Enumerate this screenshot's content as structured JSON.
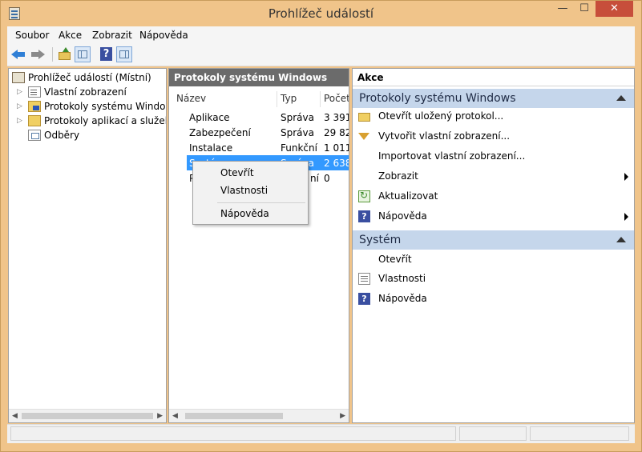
{
  "window": {
    "title": "Prohlížeč událostí",
    "close_glyph": "✕",
    "min_glyph": "—",
    "max_glyph": "☐"
  },
  "menubar": {
    "items": [
      "Soubor",
      "Akce",
      "Zobrazit",
      "Nápověda"
    ]
  },
  "tree": {
    "root": "Prohlížeč událostí (Místní)",
    "items": [
      {
        "label": "Vlastní zobrazení",
        "icon": "custom-view-icon"
      },
      {
        "label": "Protokoly systému Windows",
        "icon": "windows-logs-folder-icon"
      },
      {
        "label": "Protokoly aplikací a služeb",
        "icon": "folder-icon"
      },
      {
        "label": "Odběry",
        "icon": "subscriptions-icon"
      }
    ]
  },
  "center": {
    "header": "Protokoly systému Windows",
    "columns": [
      "Název",
      "Typ",
      "Počet"
    ],
    "rows": [
      [
        "Aplikace",
        "Správa",
        "3 391"
      ],
      [
        "Zabezpečení",
        "Správa",
        "29 82"
      ],
      [
        "Instalace",
        "Funkční",
        "1 011"
      ],
      [
        "Systém",
        "Správa",
        "2 638"
      ],
      [
        "P",
        "ní",
        "0"
      ]
    ],
    "selected_row": 3
  },
  "context_menu": {
    "items": [
      "Otevřít",
      "Vlastnosti",
      "Nápověda"
    ]
  },
  "actions": {
    "title": "Akce",
    "section1": {
      "header": "Protokoly systému Windows",
      "items": [
        {
          "label": "Otevřít uložený protokol...",
          "icon": "open-folder-icon"
        },
        {
          "label": "Vytvořit vlastní zobrazení...",
          "icon": "filter-icon"
        },
        {
          "label": "Importovat vlastní zobrazení...",
          "icon": ""
        },
        {
          "label": "Zobrazit",
          "icon": "",
          "submenu": true
        },
        {
          "label": "Aktualizovat",
          "icon": "refresh-icon"
        },
        {
          "label": "Nápověda",
          "icon": "help-icon",
          "submenu": true
        }
      ]
    },
    "section2": {
      "header": "Systém",
      "items": [
        {
          "label": "Otevřít",
          "icon": ""
        },
        {
          "label": "Vlastnosti",
          "icon": "properties-icon"
        },
        {
          "label": "Nápověda",
          "icon": "help-icon"
        }
      ]
    }
  },
  "colors": {
    "frame": "#f0c48a",
    "selection": "#3399ff",
    "section_header": "#c5d6eb",
    "close_button": "#c74e3b",
    "center_header": "#6b6b6b"
  }
}
